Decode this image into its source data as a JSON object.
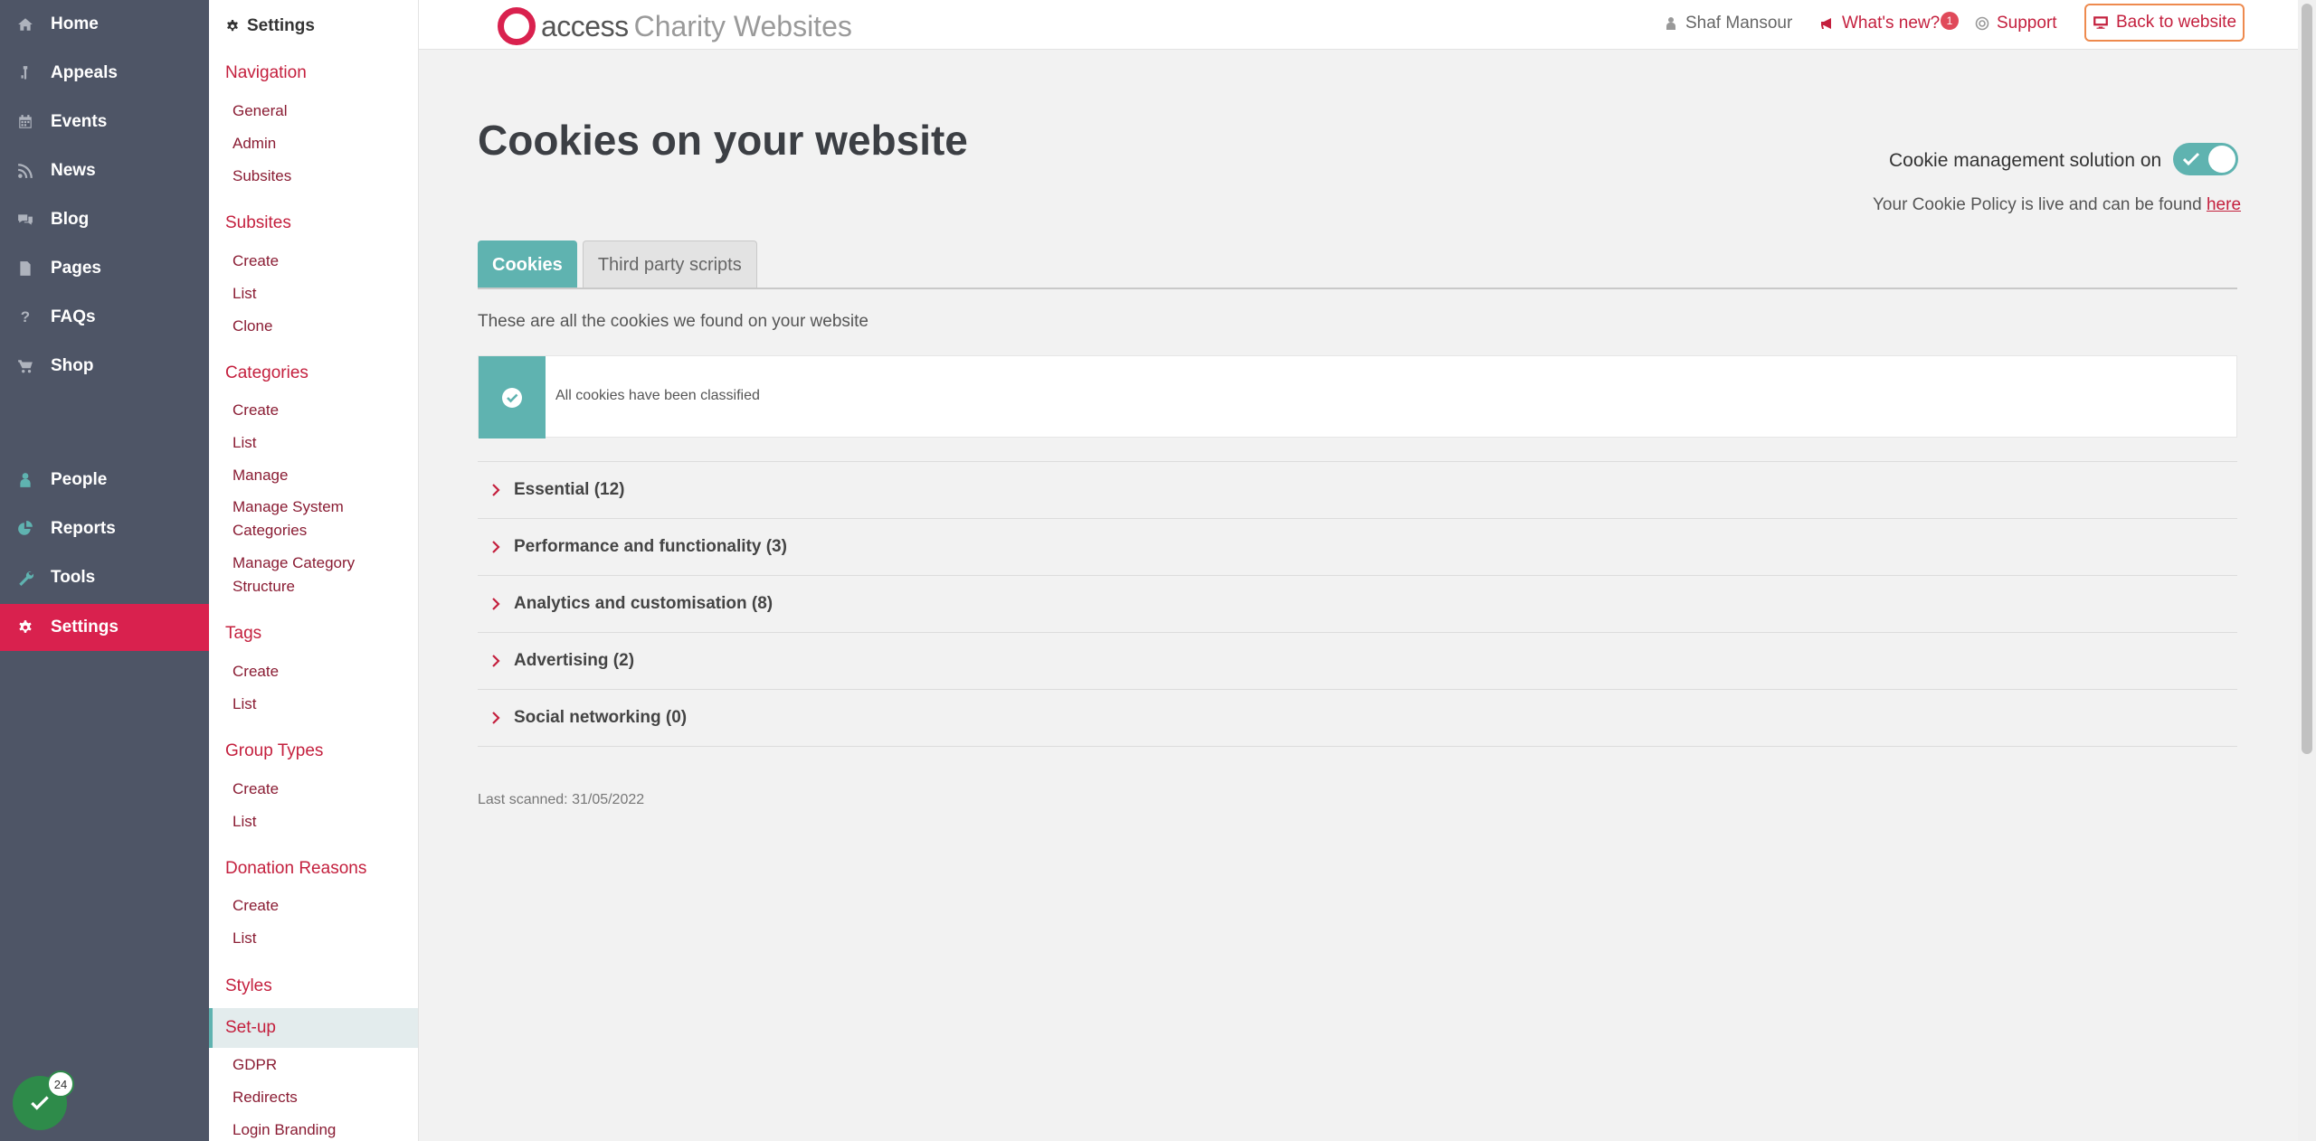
{
  "primary_nav": {
    "items": [
      {
        "label": "Home",
        "icon": "home-icon"
      },
      {
        "label": "Appeals",
        "icon": "appeals-icon"
      },
      {
        "label": "Events",
        "icon": "calendar-icon"
      },
      {
        "label": "News",
        "icon": "rss-icon"
      },
      {
        "label": "Blog",
        "icon": "comments-icon"
      },
      {
        "label": "Pages",
        "icon": "page-icon"
      },
      {
        "label": "FAQs",
        "icon": "question-icon"
      },
      {
        "label": "Shop",
        "icon": "cart-icon"
      },
      {
        "label": "People",
        "icon": "person-icon"
      },
      {
        "label": "Reports",
        "icon": "pie-chart-icon"
      },
      {
        "label": "Tools",
        "icon": "wrench-icon"
      },
      {
        "label": "Settings",
        "icon": "gear-icon",
        "active": true
      }
    ],
    "notification_count": "24"
  },
  "secondary_nav": {
    "title": "Settings",
    "sections": [
      {
        "label": "Navigation",
        "links": [
          "General",
          "Admin",
          "Subsites"
        ]
      },
      {
        "label": "Subsites",
        "links": [
          "Create",
          "List",
          "Clone"
        ]
      },
      {
        "label": "Categories",
        "links": [
          "Create",
          "List",
          "Manage",
          "Manage System Categories",
          "Manage Category Structure"
        ]
      },
      {
        "label": "Tags",
        "links": [
          "Create",
          "List"
        ]
      },
      {
        "label": "Group Types",
        "links": [
          "Create",
          "List"
        ]
      },
      {
        "label": "Donation Reasons",
        "links": [
          "Create",
          "List"
        ]
      },
      {
        "label": "Styles",
        "links": []
      },
      {
        "label": "Set-up",
        "active": true,
        "links": [
          "GDPR",
          "Redirects",
          "Login Branding"
        ]
      }
    ]
  },
  "topbar": {
    "logo_word1": "access",
    "logo_word2": "Charity Websites",
    "user_name": "Shaf Mansour",
    "whats_new_label": "What's new?",
    "whats_new_badge": "1",
    "support_label": "Support",
    "back_label": "Back to website"
  },
  "main": {
    "title": "Cookies on your website",
    "toggle_label": "Cookie management solution on",
    "toggle_on": true,
    "policy_text": "Your Cookie Policy is live and can be found",
    "policy_link": "here",
    "tabs": [
      {
        "label": "Cookies",
        "active": true
      },
      {
        "label": "Third party scripts",
        "active": false
      }
    ],
    "intro": "These are all the cookies we found on your website",
    "classified_message": "All cookies have been classified",
    "categories": [
      "Essential (12)",
      "Performance and functionality (3)",
      "Analytics and customisation (8)",
      "Advertising (2)",
      "Social networking (0)"
    ],
    "last_scanned": "Last scanned: 31/05/2022"
  },
  "colors": {
    "sidebar_bg": "#4e5566",
    "accent_red": "#d9214e",
    "teal": "#5fb3b0",
    "link_dark_red": "#8a1c33"
  }
}
